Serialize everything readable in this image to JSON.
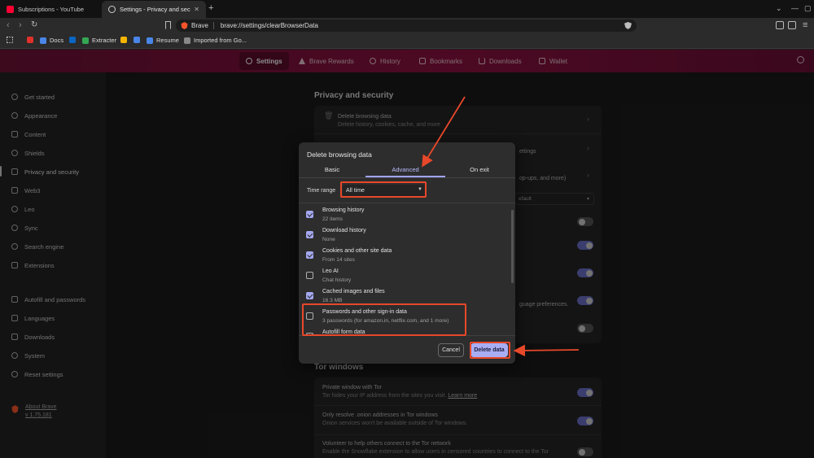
{
  "tabs": [
    {
      "label": "Subscriptions - YouTube",
      "icon": "youtube-icon"
    },
    {
      "label": "Settings - Privacy and security",
      "icon": "gear-icon"
    }
  ],
  "toolbar": {
    "browser_name": "Brave",
    "url": "brave://settings/clearBrowserData"
  },
  "bookmarks": [
    {
      "label": "",
      "color": "#e0312b"
    },
    {
      "label": "Docs",
      "color": "#4a86e8"
    },
    {
      "label": "",
      "color": "#0a66c2"
    },
    {
      "label": "Extracter",
      "color": "#34a853"
    },
    {
      "label": "",
      "color": "#f4b400"
    },
    {
      "label": "",
      "color": "#4a86e8"
    },
    {
      "label": "Resume",
      "color": "#4a86e8"
    },
    {
      "label": "Imported from Go...",
      "color": "#888888"
    }
  ],
  "settings_nav": [
    {
      "label": "Settings",
      "icon": "gear-icon"
    },
    {
      "label": "Brave Rewards",
      "icon": "triangle-icon"
    },
    {
      "label": "History",
      "icon": "clock-icon"
    },
    {
      "label": "Bookmarks",
      "icon": "bookmark-icon"
    },
    {
      "label": "Downloads",
      "icon": "download-icon"
    },
    {
      "label": "Wallet",
      "icon": "wallet-icon"
    }
  ],
  "sidebar": {
    "items": [
      {
        "label": "Get started",
        "icon": "rocket-icon"
      },
      {
        "label": "Appearance",
        "icon": "palette-icon"
      },
      {
        "label": "Content",
        "icon": "content-icon"
      },
      {
        "label": "Shields",
        "icon": "shield-icon"
      },
      {
        "label": "Privacy and security",
        "icon": "lock-icon"
      },
      {
        "label": "Web3",
        "icon": "web3-icon"
      },
      {
        "label": "Leo",
        "icon": "leo-icon"
      },
      {
        "label": "Sync",
        "icon": "sync-icon"
      },
      {
        "label": "Search engine",
        "icon": "search-icon"
      },
      {
        "label": "Extensions",
        "icon": "puzzle-icon"
      },
      {
        "label": "Autofill and passwords",
        "icon": "list-icon"
      },
      {
        "label": "Languages",
        "icon": "language-icon"
      },
      {
        "label": "Downloads",
        "icon": "download-icon"
      },
      {
        "label": "System",
        "icon": "gear-icon"
      },
      {
        "label": "Reset settings",
        "icon": "reset-icon"
      }
    ],
    "about": {
      "label": "About Brave",
      "version": "v 1.75.181"
    }
  },
  "main": {
    "privacy_title": "Privacy and security",
    "delete_row": {
      "title": "Delete browsing data",
      "subtitle": "Delete history, cookies, cache, and more"
    },
    "partial_1": "ettings",
    "partial_2": "op-ups, and more)",
    "partial_3": "efault",
    "partial_4": "guage preferences.",
    "tor_title": "Tor windows",
    "tor_rows": [
      {
        "title": "Private window with Tor",
        "subtitle": "Tor hides your IP address from the sites you visit.",
        "link": "Learn more"
      },
      {
        "title": "Only resolve .onion addresses in Tor windows",
        "subtitle": "Onion services won't be available outside of Tor windows."
      },
      {
        "title": "Volunteer to help others connect to the Tor network",
        "subtitle": "Enable the Snowflake extension to allow users in censored countries to connect to the Tor"
      }
    ]
  },
  "dialog": {
    "title": "Delete browsing data",
    "tabs": [
      "Basic",
      "Advanced",
      "On exit"
    ],
    "time_range_label": "Time range",
    "time_range_value": "All time",
    "items": [
      {
        "title": "Browsing history",
        "subtitle": "22 items",
        "checked": true
      },
      {
        "title": "Download history",
        "subtitle": "None",
        "checked": true
      },
      {
        "title": "Cookies and other site data",
        "subtitle": "From 14 sites",
        "checked": true
      },
      {
        "title": "Leo AI",
        "subtitle": "Chat history",
        "checked": false
      },
      {
        "title": "Cached images and files",
        "subtitle": "16.3 MB",
        "checked": true
      },
      {
        "title": "Passwords and other sign-in data",
        "subtitle": "3 passwords (for amazon.in, netflix.com, and 1 more)",
        "checked": false
      },
      {
        "title": "Autofill form data",
        "subtitle": "",
        "checked": false
      }
    ],
    "cancel_label": "Cancel",
    "delete_label": "Delete data"
  },
  "colors": {
    "accent": "#a9adf4",
    "annotation": "#e8482a",
    "header": "#8c1240"
  }
}
